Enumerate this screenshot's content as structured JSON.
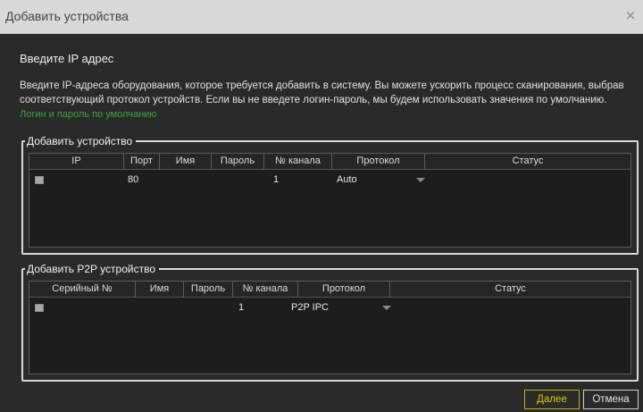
{
  "window": {
    "title": "Добавить устройства",
    "close_glyph": "×"
  },
  "heading": "Введите IP адрес",
  "description": "Введите IP-адреса оборудования, которое требуется добавить в систему. Вы можете ускорить процесс сканирования, выбрав соответствующий протокол устройств. Если вы не введете логин-пароль, мы будем использовать значения по умолчанию.",
  "link_text": "Логин и пароль по умолчанию",
  "device_group": {
    "legend": "Добавить устройство",
    "columns": [
      "IP",
      "Порт",
      "Имя",
      "Пароль",
      "№ канала",
      "Протокол",
      "Статус"
    ],
    "row": {
      "ip": "",
      "port": "80",
      "name": "",
      "password": "",
      "channel": "1",
      "protocol": "Auto",
      "status": ""
    }
  },
  "p2p_group": {
    "legend": "Добавить P2P устройство",
    "columns": [
      "Серийный №",
      "Имя",
      "Пароль",
      "№ канала",
      "Протокол",
      "Статус"
    ],
    "row": {
      "serial": "",
      "name": "",
      "password": "",
      "channel": "1",
      "protocol": "P2P IPC",
      "status": ""
    }
  },
  "buttons": {
    "next": "Далее",
    "cancel": "Отмена"
  }
}
